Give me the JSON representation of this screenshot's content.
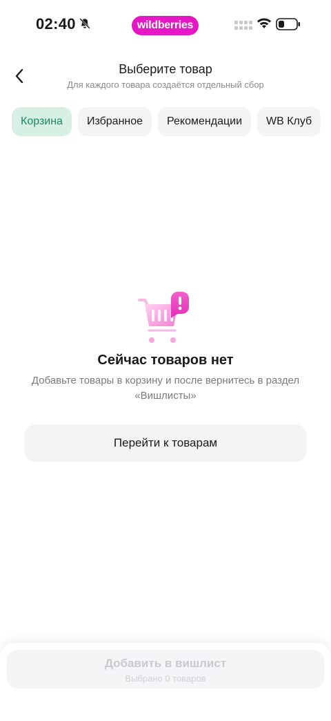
{
  "status_bar": {
    "time": "02:40",
    "brand": "wildberries",
    "icons": [
      "bell-slash-icon",
      "signal-icon",
      "wifi-icon",
      "battery-icon"
    ]
  },
  "header": {
    "title": "Выберите товар",
    "subtitle": "Для каждого товара создаётся отдельный сбор"
  },
  "tabs": [
    {
      "label": "Корзина",
      "active": true
    },
    {
      "label": "Избранное",
      "active": false
    },
    {
      "label": "Рекомендации",
      "active": false
    },
    {
      "label": "WB Клуб",
      "active": false
    }
  ],
  "empty_state": {
    "title": "Сейчас товаров нет",
    "description": "Добавьте товары в корзину и после вернитесь в раздел «Вишлисты»",
    "button_label": "Перейти к товарам",
    "icon": "empty-cart-icon"
  },
  "footer": {
    "add_label": "Добавить в вишлист",
    "selected_text": "Выбрано 0 товаров"
  },
  "colors": {
    "brand": "#e617c5",
    "active_tab_bg": "#d6f0e3",
    "active_tab_text": "#1a8a5c"
  }
}
